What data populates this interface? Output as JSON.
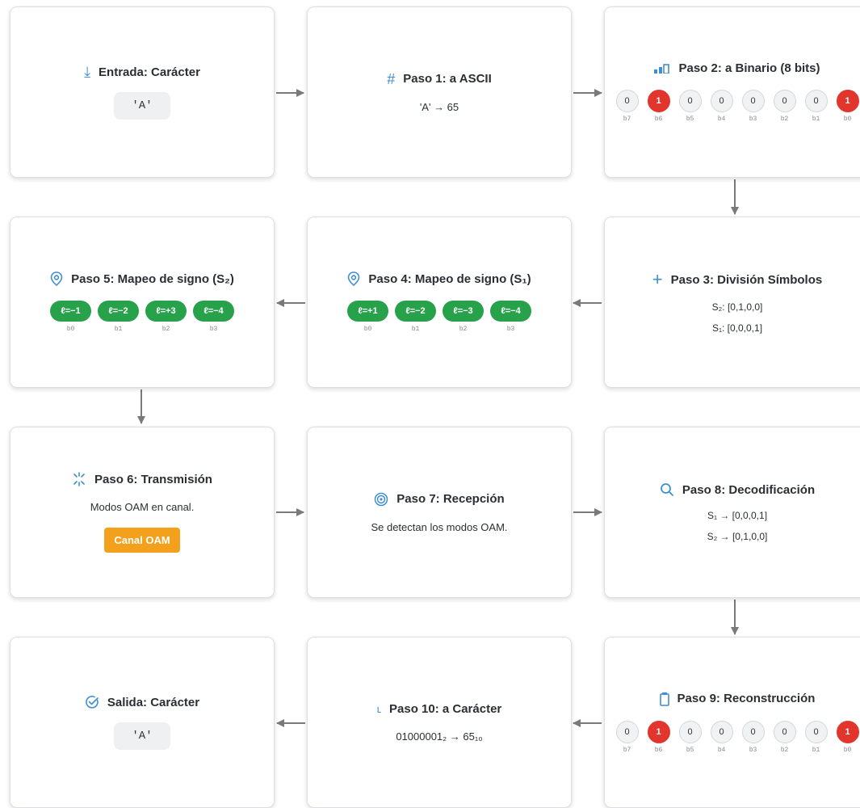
{
  "steps": {
    "entrada": {
      "title": "Entrada: Carácter",
      "icon": "download-icon",
      "value": "'A'"
    },
    "paso1": {
      "title": "Paso 1: a ASCII",
      "icon": "hash-icon",
      "text": "'A' → 65"
    },
    "paso2": {
      "title": "Paso 2: a Binario (8 bits)",
      "icon": "bar-chart-icon",
      "bits": [
        {
          "value": "0",
          "label": "b7",
          "on": false
        },
        {
          "value": "1",
          "label": "b6",
          "on": true
        },
        {
          "value": "0",
          "label": "b5",
          "on": false
        },
        {
          "value": "0",
          "label": "b4",
          "on": false
        },
        {
          "value": "0",
          "label": "b3",
          "on": false
        },
        {
          "value": "0",
          "label": "b2",
          "on": false
        },
        {
          "value": "0",
          "label": "b1",
          "on": false
        },
        {
          "value": "1",
          "label": "b0",
          "on": true
        }
      ]
    },
    "paso3": {
      "title": "Paso 3: División Símbolos",
      "icon": "plus-icon",
      "lines": [
        "S₂: [0,1,0,0]",
        "S₁: [0,0,0,1]"
      ]
    },
    "paso4": {
      "title": "Paso 4: Mapeo de signo (S₁)",
      "icon": "map-pin-icon",
      "pills": [
        {
          "label": "ℓ=+1",
          "bit": "b0"
        },
        {
          "label": "ℓ=−2",
          "bit": "b1"
        },
        {
          "label": "ℓ=−3",
          "bit": "b2"
        },
        {
          "label": "ℓ=−4",
          "bit": "b3"
        }
      ]
    },
    "paso5": {
      "title": "Paso 5: Mapeo de signo (S₂)",
      "icon": "map-pin-icon",
      "pills": [
        {
          "label": "ℓ=−1",
          "bit": "b0"
        },
        {
          "label": "ℓ=−2",
          "bit": "b1"
        },
        {
          "label": "ℓ=+3",
          "bit": "b2"
        },
        {
          "label": "ℓ=−4",
          "bit": "b3"
        }
      ]
    },
    "paso6": {
      "title": "Paso 6: Transmisión",
      "icon": "broadcast-icon",
      "text": "Modos OAM en canal.",
      "button": "Canal OAM"
    },
    "paso7": {
      "title": "Paso 7: Recepción",
      "icon": "target-icon",
      "text": "Se detectan los modos OAM."
    },
    "paso8": {
      "title": "Paso 8: Decodificación",
      "icon": "search-icon",
      "lines": [
        "S₁ → [0,0,0,1]",
        "S₂ → [0,1,0,0]"
      ]
    },
    "paso9": {
      "title": "Paso 9: Reconstrucción",
      "icon": "clipboard-icon",
      "bits": [
        {
          "value": "0",
          "label": "b7",
          "on": false
        },
        {
          "value": "1",
          "label": "b6",
          "on": true
        },
        {
          "value": "0",
          "label": "b5",
          "on": false
        },
        {
          "value": "0",
          "label": "b4",
          "on": false
        },
        {
          "value": "0",
          "label": "b3",
          "on": false
        },
        {
          "value": "0",
          "label": "b2",
          "on": false
        },
        {
          "value": "0",
          "label": "b1",
          "on": false
        },
        {
          "value": "1",
          "label": "b0",
          "on": true
        }
      ]
    },
    "paso10": {
      "title": "Paso 10: a Carácter",
      "icon": "corner-down-icon",
      "text": "01000001₂ → 65₁₀"
    },
    "salida": {
      "title": "Salida: Carácter",
      "icon": "check-circle-icon",
      "value": "'A'"
    }
  },
  "colors": {
    "accent": "#3f8fd1",
    "bit_on": "#e2352c",
    "pill": "#27a24a",
    "button": "#f3a01c",
    "arrow": "#7a7a7a"
  }
}
